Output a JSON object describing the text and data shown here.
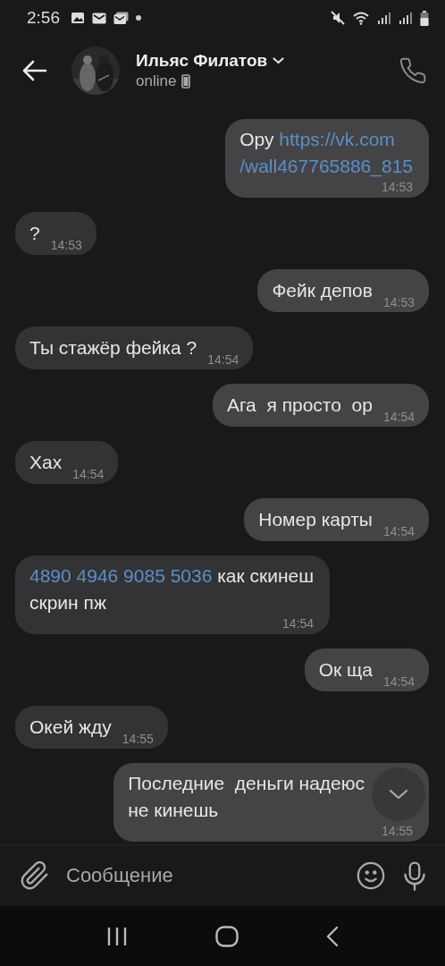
{
  "status_bar": {
    "time": "2:56"
  },
  "header": {
    "name": "Ильяс Филатов",
    "status": "online"
  },
  "messages": [
    {
      "outgoing": true,
      "kind": "long",
      "parts": [
        {
          "kind": "text",
          "text": "Ору "
        },
        {
          "kind": "link",
          "text": "https://vk.com"
        },
        {
          "kind": "break"
        },
        {
          "kind": "link",
          "text": "/wall467765886_815"
        }
      ],
      "time": "14:53"
    },
    {
      "outgoing": false,
      "kind": "short",
      "parts": [
        {
          "kind": "text",
          "text": "?"
        }
      ],
      "time": "14:53"
    },
    {
      "outgoing": true,
      "kind": "short",
      "parts": [
        {
          "kind": "text",
          "text": "Фейк депов"
        }
      ],
      "time": "14:53"
    },
    {
      "outgoing": false,
      "kind": "short",
      "parts": [
        {
          "kind": "text",
          "text": "Ты стажёр фейка ?"
        }
      ],
      "time": "14:54"
    },
    {
      "outgoing": true,
      "kind": "short",
      "parts": [
        {
          "kind": "text",
          "text": "Ага  я просто  ор"
        }
      ],
      "time": "14:54"
    },
    {
      "outgoing": false,
      "kind": "short",
      "parts": [
        {
          "kind": "text",
          "text": "Хах"
        }
      ],
      "time": "14:54"
    },
    {
      "outgoing": true,
      "kind": "short",
      "parts": [
        {
          "kind": "text",
          "text": "Номер карты"
        }
      ],
      "time": "14:54"
    },
    {
      "outgoing": false,
      "kind": "long",
      "parts": [
        {
          "kind": "link",
          "text": "4890 4946 9085 5036"
        },
        {
          "kind": "text",
          "text": " как скинеш"
        },
        {
          "kind": "break"
        },
        {
          "kind": "text",
          "text": "скрин пж"
        }
      ],
      "time": "14:54"
    },
    {
      "outgoing": true,
      "kind": "short",
      "parts": [
        {
          "kind": "text",
          "text": "Ок ща"
        }
      ],
      "time": "14:54"
    },
    {
      "outgoing": false,
      "kind": "short",
      "parts": [
        {
          "kind": "text",
          "text": "Окей жду"
        }
      ],
      "time": "14:55"
    },
    {
      "outgoing": true,
      "kind": "long",
      "parts": [
        {
          "kind": "text",
          "text": "Последние  деньги надеюс"
        },
        {
          "kind": "break"
        },
        {
          "kind": "text",
          "text": "не кинешь"
        }
      ],
      "time": "14:55"
    }
  ],
  "composer": {
    "placeholder": "Сообщение"
  }
}
